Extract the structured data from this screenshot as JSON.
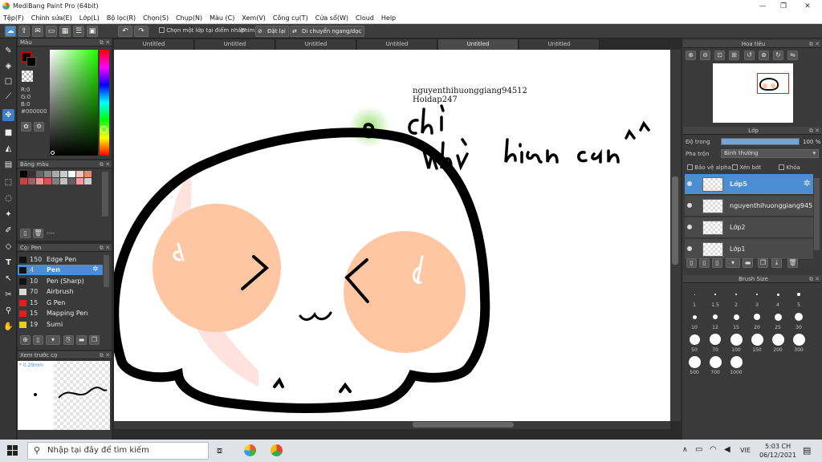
{
  "window": {
    "title": "MediBang Paint Pro (64bit)"
  },
  "menu": [
    "Tệp(F)",
    "Chỉnh sửa(E)",
    "Lớp(L)",
    "Bộ lọc(R)",
    "Chọn(S)",
    "Chụp(N)",
    "Màu (C)",
    "Xem(V)",
    "Công cụ(T)",
    "Cửa sổ(W)",
    "Cloud",
    "Help"
  ],
  "toolbar": {
    "select_one_layer_label": "Chọn một lớp tại điểm nhấp",
    "key_label": "Phím",
    "reset_label": "Đặt lại",
    "flip_label": "Di chuyển ngang/dọc"
  },
  "color_panel": {
    "title": "Màu",
    "r": "R:0",
    "g": "G:0",
    "b": "B:0",
    "hex": "#000000",
    "primary": "#cc0000",
    "secondary": "#000000"
  },
  "palette_panel": {
    "title": "Bảng màu",
    "field": "----",
    "swatches": [
      "#000000",
      "#333333",
      "#666666",
      "#888888",
      "#aaaaaa",
      "#cccccc",
      "#ffffff",
      "#f5c6b0",
      "#e88a6a",
      "#d04040",
      "#a06060",
      "#f09090",
      "#e05050",
      "#808080",
      "#c0c0c0",
      "#606060",
      "#ff9999",
      "#d0d0d0"
    ]
  },
  "brush_panel": {
    "title": "Cọ: Pen",
    "brushes": [
      {
        "size": "150",
        "name": "Edge Pen",
        "color": "#111111"
      },
      {
        "size": "4",
        "name": "Pen",
        "color": "#111111"
      },
      {
        "size": "10",
        "name": "Pen (Sharp)",
        "color": "#111111"
      },
      {
        "size": "70",
        "name": "Airbrush",
        "color": "#d9d9d9"
      },
      {
        "size": "15",
        "name": "G Pen",
        "color": "#e02020"
      },
      {
        "size": "15",
        "name": "Mapping Pen",
        "color": "#e02020"
      },
      {
        "size": "19",
        "name": "Sumi",
        "color": "#e0d020"
      }
    ]
  },
  "preview_panel": {
    "title": "Xem trước cọ",
    "size": "* 0.29mm"
  },
  "tabs": [
    "Untitled",
    "Untitled",
    "Untitled",
    "Untitled",
    "Untitled",
    "Untitled"
  ],
  "canvas": {
    "watermark1": "nguyenthihuonggiang94512",
    "watermark2": "Hoidap247"
  },
  "navigator": {
    "title": "Hoa tiêu"
  },
  "layer_panel": {
    "title": "Lớp",
    "opacity_label": "Độ trong",
    "opacity_value": "100 %",
    "opacity_level": 1.0,
    "blend_label": "Pha trộn",
    "blend_value": "Bình thường",
    "protect_alpha": "Bảo vệ alpha",
    "clipping": "Xén bớt",
    "lock": "Khóa",
    "layers": [
      "Lớp5",
      "nguyenthihuonggiang94512",
      "Lớp2",
      "Lớp1"
    ]
  },
  "brush_size": {
    "title": "Brush Size",
    "sizes": [
      "1",
      "1.5",
      "2",
      "3",
      "4",
      "5",
      "10",
      "12",
      "15",
      "20",
      "25",
      "30",
      "50",
      "70",
      "100",
      "150",
      "200",
      "300",
      "500",
      "700",
      "1000"
    ]
  },
  "taskbar": {
    "search_placeholder": "Nhập tại đây để tìm kiếm",
    "lang": "VIE",
    "time": "5:03 CH",
    "date": "06/12/2021"
  }
}
